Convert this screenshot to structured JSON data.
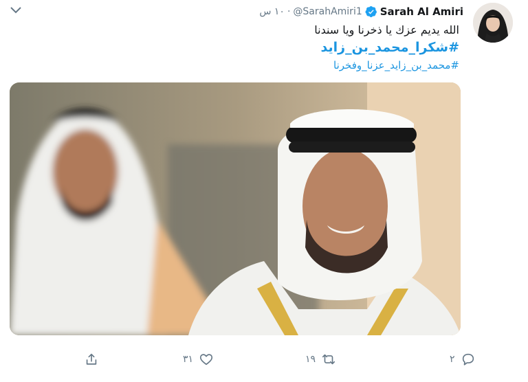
{
  "tweet": {
    "author_name": "Sarah Al Amiri",
    "handle": "@SarahAmiri1",
    "separator": "·",
    "time": "١٠ س",
    "text_line1": "الله يديم عزك يا ذخرنا ويا سندنا",
    "hashtag1": "#شكرا_محمد_بن_زايد",
    "hashtag2": "#محمد_بن_زايد_عزنا_وفخرنا"
  },
  "actions": {
    "reply_count": "٢",
    "retweet_count": "١٩",
    "like_count": "٣١"
  },
  "icons": {
    "verified": "verified-badge-icon",
    "more": "chevron-down-icon",
    "reply": "reply-icon",
    "retweet": "retweet-icon",
    "like": "heart-icon",
    "share": "share-icon"
  },
  "colors": {
    "link": "#1b95e0",
    "muted": "#657786",
    "text": "#14171a"
  }
}
